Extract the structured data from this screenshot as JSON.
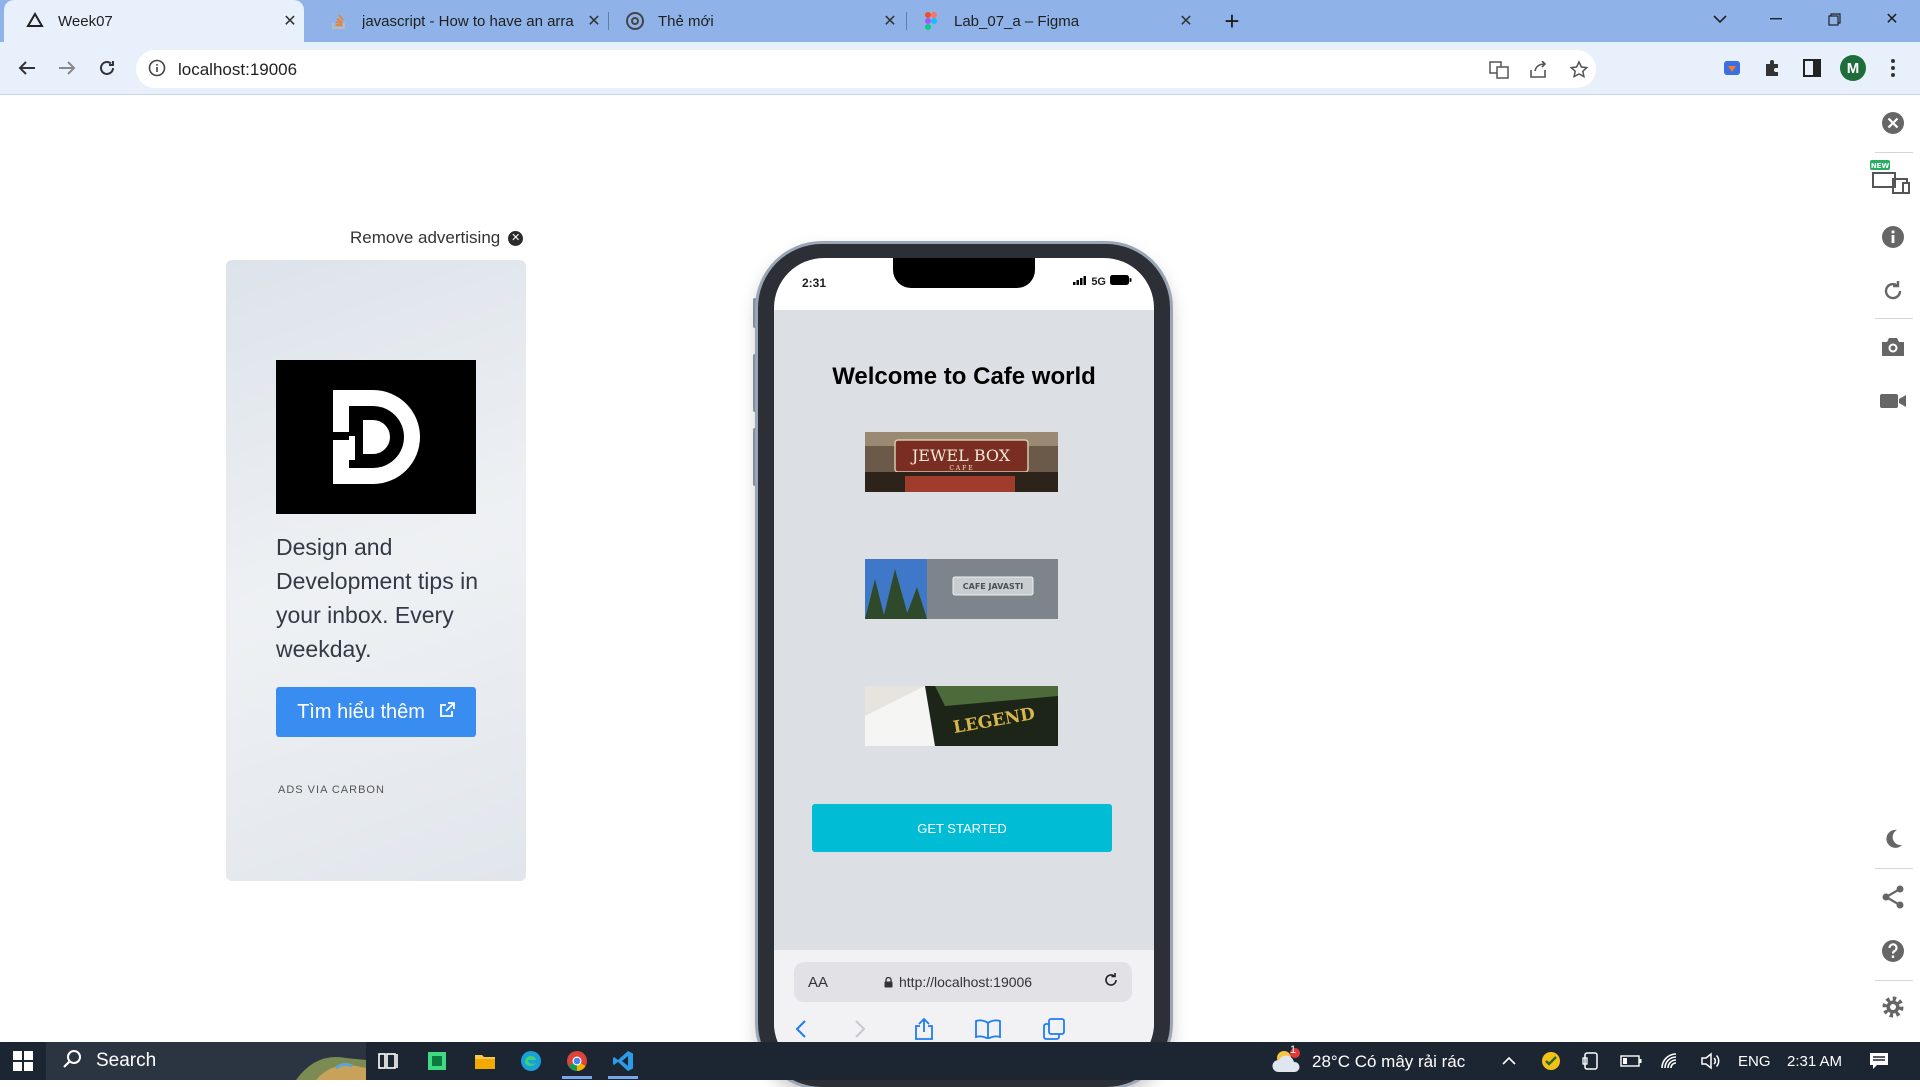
{
  "browser": {
    "tabs": [
      {
        "title": "Week07",
        "active": true,
        "favicon": "expo-icon"
      },
      {
        "title": "javascript - How to have an arra",
        "active": false,
        "favicon": "stackoverflow-icon"
      },
      {
        "title": "Thẻ mới",
        "active": false,
        "favicon": "chrome-icon"
      },
      {
        "title": "Lab_07_a – Figma",
        "active": false,
        "favicon": "figma-icon"
      }
    ],
    "url": "localhost:19006",
    "profile_initial": "M"
  },
  "ad": {
    "remove_label": "Remove advertising",
    "text": "Design and Development tips in your inbox. Every weekday.",
    "button_label": "Tìm hiểu thêm",
    "via": "ADS VIA CARBON"
  },
  "phone": {
    "time": "2:31",
    "network": "5G",
    "title": "Welcome to Cafe world",
    "cafes": [
      {
        "sign": "JEWEL BOX",
        "sub": "C A F E"
      },
      {
        "sign": "CAFE JAVASTI"
      },
      {
        "sign": "LEGEND"
      }
    ],
    "button_label": "GET STARTED",
    "safari_aa": "AA",
    "safari_url": "http://localhost:19006"
  },
  "taskbar": {
    "search_label": "Search",
    "weather": "28°C  Có mây rải rác",
    "weather_badge": "1",
    "lang": "ENG",
    "time": "2:31 AM"
  },
  "colors": {
    "accent_chrome": "#8fb3e8",
    "get_started": "#00bcd4",
    "ad_button": "#3a8df0",
    "taskbar": "#1c2633"
  }
}
